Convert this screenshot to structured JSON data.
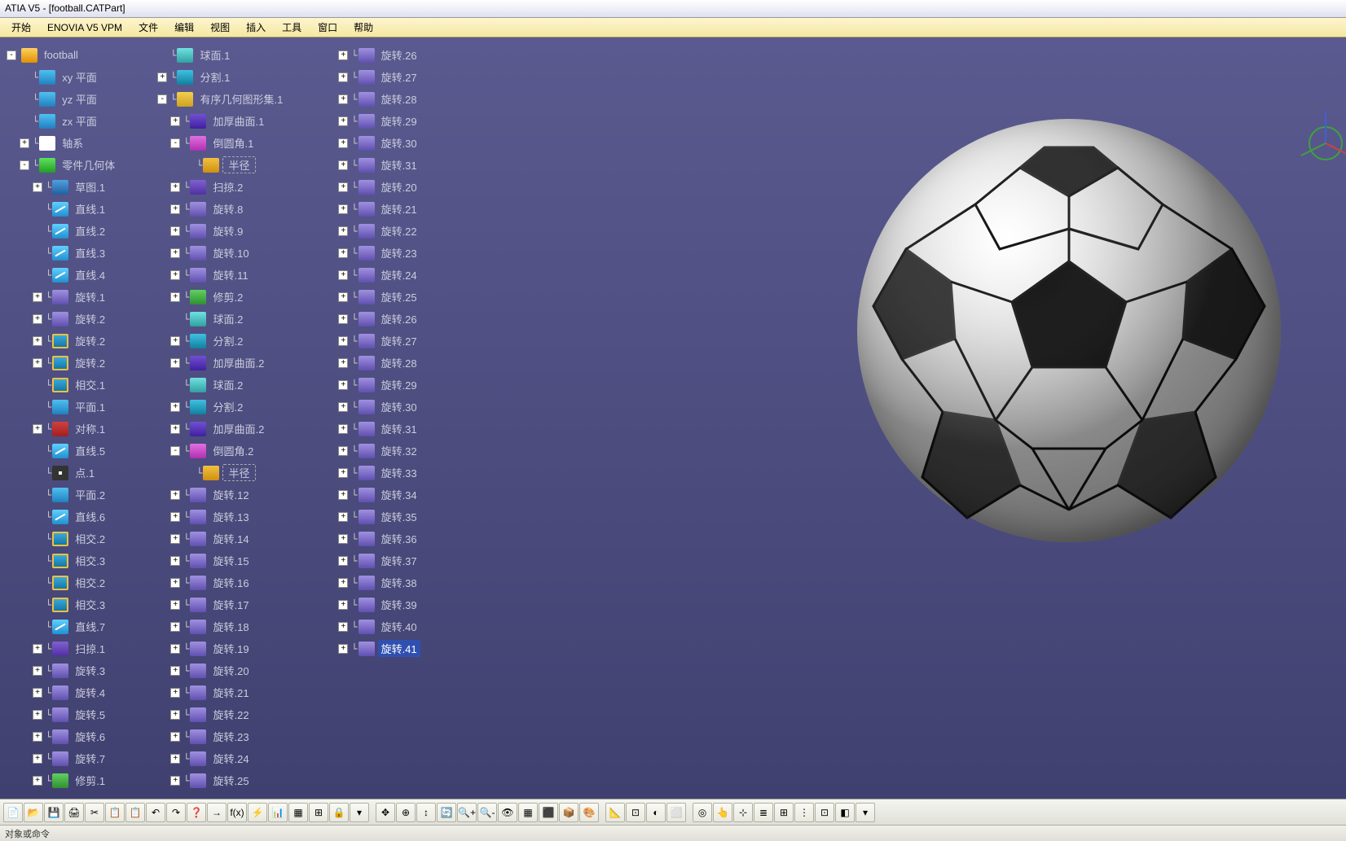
{
  "title": "ATIA V5 - [football.CATPart]",
  "menu": [
    "开始",
    "ENOVIA V5 VPM",
    "文件",
    "编辑",
    "视图",
    "插入",
    "工具",
    "窗口",
    "帮助"
  ],
  "status": "对象或命令",
  "tree": [
    {
      "d": 0,
      "e": "-",
      "ic": "gear",
      "l": "football"
    },
    {
      "d": 1,
      "e": "",
      "ic": "plane",
      "l": "xy 平面"
    },
    {
      "d": 1,
      "e": "",
      "ic": "plane",
      "l": "yz 平面"
    },
    {
      "d": 1,
      "e": "",
      "ic": "plane",
      "l": "zx 平面"
    },
    {
      "d": 1,
      "e": "+",
      "ic": "axis",
      "l": "轴系"
    },
    {
      "d": 1,
      "e": "-",
      "ic": "body",
      "l": "零件几何体"
    },
    {
      "d": 2,
      "e": "+",
      "ic": "sketch",
      "l": "草图.1"
    },
    {
      "d": 2,
      "e": "",
      "ic": "line",
      "l": "直线.1"
    },
    {
      "d": 2,
      "e": "",
      "ic": "line",
      "l": "直线.2"
    },
    {
      "d": 2,
      "e": "",
      "ic": "line",
      "l": "直线.3"
    },
    {
      "d": 2,
      "e": "",
      "ic": "line",
      "l": "直线.4"
    },
    {
      "d": 2,
      "e": "+",
      "ic": "rotate",
      "l": "旋转.1"
    },
    {
      "d": 2,
      "e": "+",
      "ic": "rotate",
      "l": "旋转.2"
    },
    {
      "d": 2,
      "e": "+",
      "ic": "intersect",
      "l": "旋转.2"
    },
    {
      "d": 2,
      "e": "+",
      "ic": "intersect",
      "l": "旋转.2"
    },
    {
      "d": 2,
      "e": "",
      "ic": "intersect",
      "l": "相交.1"
    },
    {
      "d": 2,
      "e": "",
      "ic": "plane",
      "l": "平面.1"
    },
    {
      "d": 2,
      "e": "+",
      "ic": "sym",
      "l": "对称.1"
    },
    {
      "d": 2,
      "e": "",
      "ic": "line",
      "l": "直线.5"
    },
    {
      "d": 2,
      "e": "",
      "ic": "point",
      "l": "点.1"
    },
    {
      "d": 2,
      "e": "",
      "ic": "plane",
      "l": "平面.2"
    },
    {
      "d": 2,
      "e": "",
      "ic": "line",
      "l": "直线.6"
    },
    {
      "d": 2,
      "e": "",
      "ic": "intersect",
      "l": "相交.2"
    },
    {
      "d": 2,
      "e": "",
      "ic": "intersect",
      "l": "相交.3"
    },
    {
      "d": 2,
      "e": "",
      "ic": "intersect",
      "l": "相交.2"
    },
    {
      "d": 2,
      "e": "",
      "ic": "intersect",
      "l": "相交.3"
    },
    {
      "d": 2,
      "e": "",
      "ic": "line",
      "l": "直线.7"
    },
    {
      "d": 2,
      "e": "+",
      "ic": "sweep",
      "l": "扫掠.1"
    },
    {
      "d": 2,
      "e": "+",
      "ic": "rotate",
      "l": "旋转.3"
    },
    {
      "d": 2,
      "e": "+",
      "ic": "rotate",
      "l": "旋转.4"
    },
    {
      "d": 2,
      "e": "+",
      "ic": "rotate",
      "l": "旋转.5"
    },
    {
      "d": 2,
      "e": "+",
      "ic": "rotate",
      "l": "旋转.6"
    },
    {
      "d": 2,
      "e": "+",
      "ic": "rotate",
      "l": "旋转.7"
    },
    {
      "d": 2,
      "e": "+",
      "ic": "trim",
      "l": "修剪.1"
    },
    {
      "d": 2,
      "e": "",
      "ic": "surf",
      "l": "球面.1"
    },
    {
      "d": 2,
      "e": "+",
      "ic": "split",
      "l": "分割.1"
    },
    {
      "d": 2,
      "e": "-",
      "ic": "geoset",
      "l": "有序几何图形集.1"
    },
    {
      "d": 3,
      "e": "+",
      "ic": "thick",
      "l": "加厚曲面.1"
    },
    {
      "d": 3,
      "e": "-",
      "ic": "fillet",
      "l": "倒圆角.1"
    },
    {
      "d": 4,
      "e": "",
      "ic": "radius",
      "l": "半径",
      "r": 1
    },
    {
      "d": 3,
      "e": "+",
      "ic": "sweep",
      "l": "扫掠.2"
    },
    {
      "d": 3,
      "e": "+",
      "ic": "rotate",
      "l": "旋转.8"
    },
    {
      "d": 3,
      "e": "+",
      "ic": "rotate",
      "l": "旋转.9"
    },
    {
      "d": 3,
      "e": "+",
      "ic": "rotate",
      "l": "旋转.10"
    },
    {
      "d": 3,
      "e": "+",
      "ic": "rotate",
      "l": "旋转.11"
    },
    {
      "d": 3,
      "e": "+",
      "ic": "trim",
      "l": "修剪.2"
    },
    {
      "d": 3,
      "e": "",
      "ic": "surf",
      "l": "球面.2"
    },
    {
      "d": 3,
      "e": "+",
      "ic": "split",
      "l": "分割.2"
    },
    {
      "d": 3,
      "e": "+",
      "ic": "thick",
      "l": "加厚曲面.2"
    },
    {
      "d": 3,
      "e": "",
      "ic": "surf",
      "l": "球面.2"
    },
    {
      "d": 3,
      "e": "+",
      "ic": "split",
      "l": "分割.2"
    },
    {
      "d": 3,
      "e": "+",
      "ic": "thick",
      "l": "加厚曲面.2"
    },
    {
      "d": 3,
      "e": "-",
      "ic": "fillet",
      "l": "倒圆角.2"
    },
    {
      "d": 4,
      "e": "",
      "ic": "radius",
      "l": "半径",
      "r": 1
    },
    {
      "d": 3,
      "e": "+",
      "ic": "rotate",
      "l": "旋转.12"
    },
    {
      "d": 3,
      "e": "+",
      "ic": "rotate",
      "l": "旋转.13"
    },
    {
      "d": 3,
      "e": "+",
      "ic": "rotate",
      "l": "旋转.14"
    },
    {
      "d": 3,
      "e": "+",
      "ic": "rotate",
      "l": "旋转.15"
    },
    {
      "d": 3,
      "e": "+",
      "ic": "rotate",
      "l": "旋转.16"
    },
    {
      "d": 3,
      "e": "+",
      "ic": "rotate",
      "l": "旋转.17"
    },
    {
      "d": 3,
      "e": "+",
      "ic": "rotate",
      "l": "旋转.18"
    },
    {
      "d": 3,
      "e": "+",
      "ic": "rotate",
      "l": "旋转.19"
    },
    {
      "d": 3,
      "e": "+",
      "ic": "rotate",
      "l": "旋转.20"
    },
    {
      "d": 3,
      "e": "+",
      "ic": "rotate",
      "l": "旋转.21"
    },
    {
      "d": 3,
      "e": "+",
      "ic": "rotate",
      "l": "旋转.22"
    },
    {
      "d": 3,
      "e": "+",
      "ic": "rotate",
      "l": "旋转.23"
    },
    {
      "d": 3,
      "e": "+",
      "ic": "rotate",
      "l": "旋转.24"
    },
    {
      "d": 3,
      "e": "+",
      "ic": "rotate",
      "l": "旋转.25"
    },
    {
      "d": 3,
      "e": "+",
      "ic": "rotate",
      "l": "旋转.26"
    },
    {
      "d": 3,
      "e": "+",
      "ic": "rotate",
      "l": "旋转.27"
    },
    {
      "d": 3,
      "e": "+",
      "ic": "rotate",
      "l": "旋转.28"
    },
    {
      "d": 3,
      "e": "+",
      "ic": "rotate",
      "l": "旋转.29"
    },
    {
      "d": 3,
      "e": "+",
      "ic": "rotate",
      "l": "旋转.30"
    },
    {
      "d": 3,
      "e": "+",
      "ic": "rotate",
      "l": "旋转.31"
    },
    {
      "d": 3,
      "e": "+",
      "ic": "rotate",
      "l": "旋转.20"
    },
    {
      "d": 3,
      "e": "+",
      "ic": "rotate",
      "l": "旋转.21"
    },
    {
      "d": 3,
      "e": "+",
      "ic": "rotate",
      "l": "旋转.22"
    },
    {
      "d": 3,
      "e": "+",
      "ic": "rotate",
      "l": "旋转.23"
    },
    {
      "d": 3,
      "e": "+",
      "ic": "rotate",
      "l": "旋转.24"
    },
    {
      "d": 3,
      "e": "+",
      "ic": "rotate",
      "l": "旋转.25"
    },
    {
      "d": 3,
      "e": "+",
      "ic": "rotate",
      "l": "旋转.26"
    },
    {
      "d": 3,
      "e": "+",
      "ic": "rotate",
      "l": "旋转.27"
    },
    {
      "d": 3,
      "e": "+",
      "ic": "rotate",
      "l": "旋转.28"
    },
    {
      "d": 3,
      "e": "+",
      "ic": "rotate",
      "l": "旋转.29"
    },
    {
      "d": 3,
      "e": "+",
      "ic": "rotate",
      "l": "旋转.30"
    },
    {
      "d": 3,
      "e": "+",
      "ic": "rotate",
      "l": "旋转.31"
    },
    {
      "d": 3,
      "e": "+",
      "ic": "rotate",
      "l": "旋转.32"
    },
    {
      "d": 3,
      "e": "+",
      "ic": "rotate",
      "l": "旋转.33"
    },
    {
      "d": 3,
      "e": "+",
      "ic": "rotate",
      "l": "旋转.34"
    },
    {
      "d": 3,
      "e": "+",
      "ic": "rotate",
      "l": "旋转.35"
    },
    {
      "d": 3,
      "e": "+",
      "ic": "rotate",
      "l": "旋转.36"
    },
    {
      "d": 3,
      "e": "+",
      "ic": "rotate",
      "l": "旋转.37"
    },
    {
      "d": 3,
      "e": "+",
      "ic": "rotate",
      "l": "旋转.38"
    },
    {
      "d": 3,
      "e": "+",
      "ic": "rotate",
      "l": "旋转.39"
    },
    {
      "d": 3,
      "e": "+",
      "ic": "rotate",
      "l": "旋转.40"
    },
    {
      "d": 3,
      "e": "+",
      "ic": "rotate",
      "l": "旋转.41",
      "sel": 1
    }
  ],
  "toolbar_icons": [
    "📄",
    "📂",
    "💾",
    "🖨",
    "✂",
    "📋",
    "📋",
    "↶",
    "↷",
    "❓",
    "→",
    "f(x)",
    "⚡",
    "📊",
    "▦",
    "⊞",
    "🔒",
    "▾",
    "",
    "✥",
    "⊕",
    "↕",
    "🔄",
    "🔍+",
    "🔍-",
    "👁",
    "▦",
    "⬛",
    "📦",
    "🎨",
    "",
    "📐",
    "⊡",
    "◐",
    "⬜",
    "",
    "◎",
    "👆",
    "⊹",
    "≣",
    "⊞",
    "⋮",
    "⊡",
    "◧",
    "▾"
  ]
}
